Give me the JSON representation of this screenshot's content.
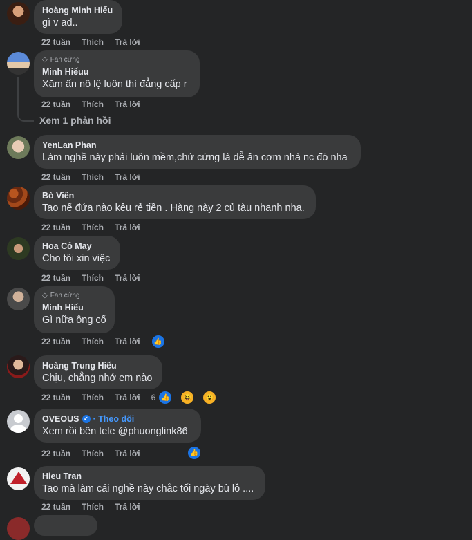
{
  "comments": [
    {
      "author": "Hoàng Minh Hiếu",
      "text": "gì v ad..",
      "time": "22 tuần",
      "like": "Thích",
      "reply": "Trả lời"
    },
    {
      "badge": "Fan cứng",
      "author": "Minh Hiếuu",
      "text": "Xăm ấn nô lệ luôn thì đẳng cấp r",
      "time": "22 tuần",
      "like": "Thích",
      "reply": "Trả lời",
      "see_replies": "Xem 1 phản hồi"
    },
    {
      "author": "YenLan Phan",
      "text": "Làm nghề này phải luôn mềm,chứ cứng là dễ ăn cơm nhà nc đó nha",
      "time": "22 tuần",
      "like": "Thích",
      "reply": "Trả lời"
    },
    {
      "author": "Bò Viên",
      "text": "Tao nể đứa nào kêu rẻ tiền . Hàng này 2 củ tàu nhanh nha.",
      "time": "22 tuần",
      "like": "Thích",
      "reply": "Trả lời"
    },
    {
      "author": "Hoa Cỏ May",
      "text": "Cho tôi xin việc",
      "time": "22 tuần",
      "like": "Thích",
      "reply": "Trả lời"
    },
    {
      "badge": "Fan cứng",
      "author": "Minh Hiếu",
      "text": "Gì nữa ông cố",
      "time": "22 tuần",
      "like": "Thích",
      "reply": "Trả lời"
    },
    {
      "author": "Hoàng Trung Hiếu",
      "text": "Chịu, chẳng nhớ em nào",
      "time": "22 tuần",
      "like": "Thích",
      "reply": "Trả lời",
      "reaction_count": "6"
    },
    {
      "author": "OVEOUS",
      "follow": "· Theo dõi",
      "text": "Xem rồi bên tele @phuonglink86",
      "time": "22 tuần",
      "like": "Thích",
      "reply": "Trả lời"
    },
    {
      "author": "Hieu Tran",
      "text": "Tao mà làm cái nghề này chắc tối ngày bù lỗ ....",
      "time": "22 tuần",
      "like": "Thích",
      "reply": "Trả lời"
    }
  ],
  "icons": {
    "like": "thumbs-up-icon",
    "haha": "laughing-emoji-icon",
    "wow": "wow-emoji-icon",
    "diamond": "diamond-icon",
    "verified": "verified-check-icon"
  },
  "colors": {
    "background": "#242526",
    "bubble": "#3a3b3c",
    "accent": "#1b74e4",
    "link": "#4599ff"
  }
}
